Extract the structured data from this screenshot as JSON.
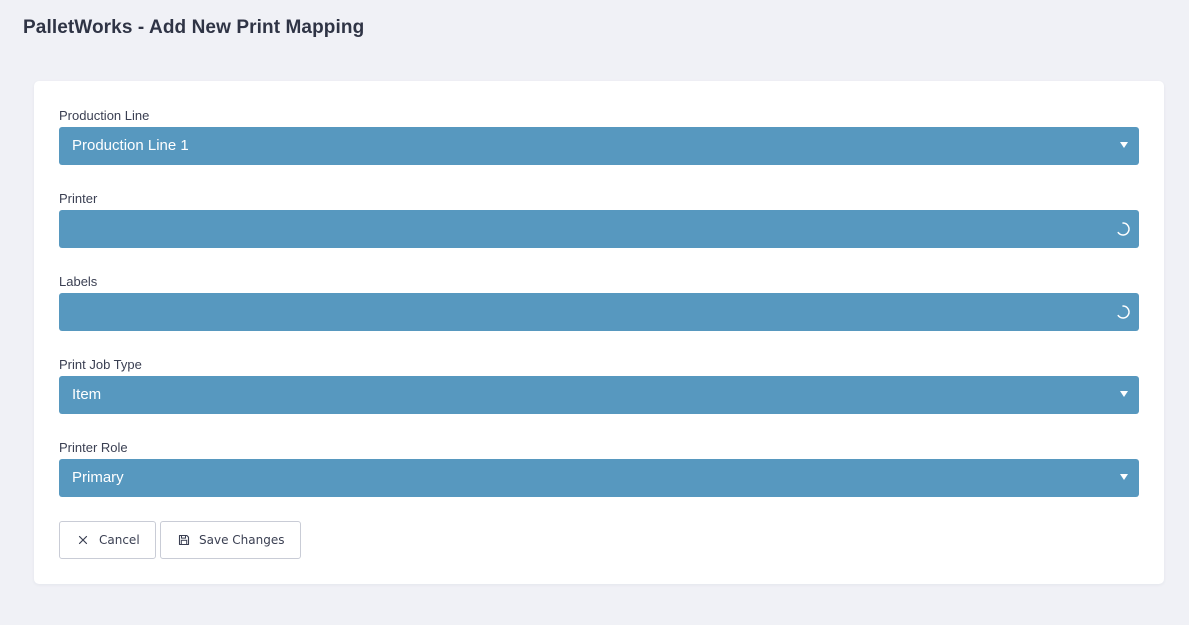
{
  "header": {
    "title": "PalletWorks - Add New Print Mapping"
  },
  "form": {
    "fields": [
      {
        "label": "Production Line",
        "value": "Production Line 1",
        "state": "dropdown",
        "icon": "chevron-down-icon"
      },
      {
        "label": "Printer",
        "value": "",
        "state": "loading",
        "icon": "loading-spinner-icon"
      },
      {
        "label": "Labels",
        "value": "",
        "state": "loading",
        "icon": "loading-spinner-icon"
      },
      {
        "label": "Print Job Type",
        "value": "Item",
        "state": "dropdown",
        "icon": "chevron-down-icon"
      },
      {
        "label": "Printer Role",
        "value": "Primary",
        "state": "dropdown",
        "icon": "chevron-down-icon"
      }
    ],
    "buttons": {
      "cancel_label": "Cancel",
      "cancel_icon": "close-icon",
      "save_label": "Save Changes",
      "save_icon": "floppy-disk-icon"
    }
  },
  "colors": {
    "page_background": "#f0f1f6",
    "card_background": "#ffffff",
    "select_background": "#5798bf",
    "select_text": "#ffffff",
    "text": "#2f3445"
  }
}
